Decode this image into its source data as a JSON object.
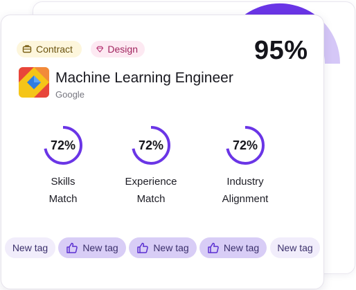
{
  "overall": {
    "score": "95%",
    "fill_fraction": 0.95
  },
  "chips": [
    {
      "label": "Contract",
      "icon": "briefcase-icon"
    },
    {
      "label": "Design",
      "icon": "diamond-icon"
    }
  ],
  "job": {
    "title": "Machine Learning Engineer",
    "company": "Google",
    "logo": "company-logo"
  },
  "metrics": [
    {
      "percent": "72%",
      "line1": "Skills",
      "line2": "Match",
      "fraction": 0.72
    },
    {
      "percent": "72%",
      "line1": "Experience",
      "line2": "Match",
      "fraction": 0.72
    },
    {
      "percent": "72%",
      "line1": "Industry",
      "line2": "Alignment",
      "fraction": 0.72
    }
  ],
  "tags": [
    {
      "label": "New tag",
      "thumb": false
    },
    {
      "label": "New tag",
      "thumb": true,
      "icon": "thumbs-up-icon"
    },
    {
      "label": "New tag",
      "thumb": true,
      "icon": "thumbs-up-icon"
    },
    {
      "label": "New tag",
      "thumb": true,
      "icon": "thumbs-up-icon"
    },
    {
      "label": "New tag",
      "thumb": false
    }
  ],
  "colors": {
    "accent": "#6a35e6",
    "accent_light": "#d5c7f7",
    "contract_bg": "#fdf6dc",
    "design_bg": "#fde9f2"
  }
}
